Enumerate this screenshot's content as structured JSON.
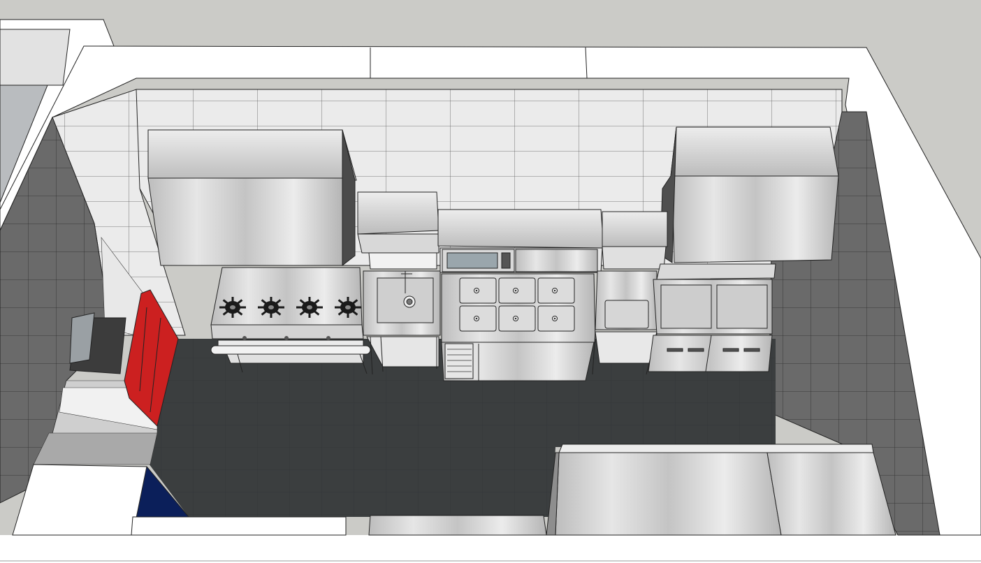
{
  "scene": {
    "view": "3d-kitchen-model-top-perspective",
    "colors": {
      "sky": "#cbcbc7",
      "wall_top": "#ffffff",
      "tile_light": "#ececec",
      "tile_dark": "#6e6e6e",
      "floor": "#3a3d3e",
      "steel_light": "#e4e4e4",
      "steel_mid": "#c6c6c6",
      "steel_dark": "#8f8f8f",
      "red_door": "#cc2020",
      "navy_panel": "#0b1f5a",
      "burner": "#1a1a1a"
    },
    "equipment": [
      {
        "name": "left-exhaust-hood"
      },
      {
        "name": "right-exhaust-hood"
      },
      {
        "name": "four-burner-range"
      },
      {
        "name": "single-bowl-sink"
      },
      {
        "name": "microwave-oven"
      },
      {
        "name": "bain-marie-warmer"
      },
      {
        "name": "undercounter-refrigerator"
      },
      {
        "name": "prep-table-with-sink"
      },
      {
        "name": "double-deep-fryer"
      },
      {
        "name": "island-work-table"
      },
      {
        "name": "red-storage-locker"
      }
    ],
    "burner_count": 4,
    "warmer_well_count": 6,
    "fryer_basket_count": 2
  }
}
